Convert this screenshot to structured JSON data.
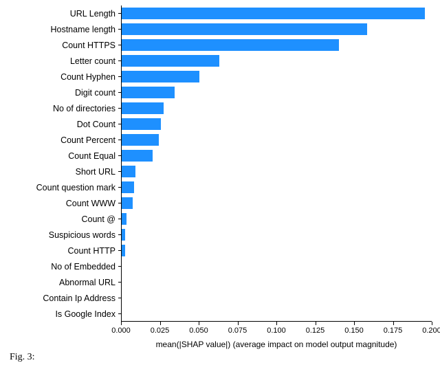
{
  "chart_data": {
    "type": "bar",
    "orientation": "horizontal",
    "categories": [
      "URL Length",
      "Hostname length",
      "Count HTTPS",
      "Letter count",
      "Count Hyphen",
      "Digit count",
      "No of directories",
      "Dot Count",
      "Count Percent",
      "Count Equal",
      "Short URL",
      "Count question mark",
      "Count WWW",
      "Count @",
      "Suspicious words",
      "Count HTTP",
      "No of Embedded",
      "Abnormal URL",
      "Contain Ip Address",
      "Is Google Index"
    ],
    "values": [
      0.195,
      0.158,
      0.14,
      0.063,
      0.05,
      0.034,
      0.027,
      0.025,
      0.024,
      0.02,
      0.009,
      0.008,
      0.007,
      0.003,
      0.002,
      0.002,
      0.0,
      0.0,
      0.0,
      0.0
    ],
    "xlabel": "mean(|SHAP value|) (average impact on model output magnitude)",
    "ylabel": "",
    "title": "",
    "xlim": [
      0.0,
      0.2
    ],
    "x_ticks": [
      0.0,
      0.025,
      0.05,
      0.075,
      0.1,
      0.125,
      0.15,
      0.175,
      0.2
    ],
    "x_tick_labels": [
      "0.000",
      "0.025",
      "0.050",
      "0.075",
      "0.100",
      "0.125",
      "0.150",
      "0.175",
      "0.200"
    ],
    "bar_color": "#1e90ff"
  },
  "caption_prefix": "Fig. 3: "
}
